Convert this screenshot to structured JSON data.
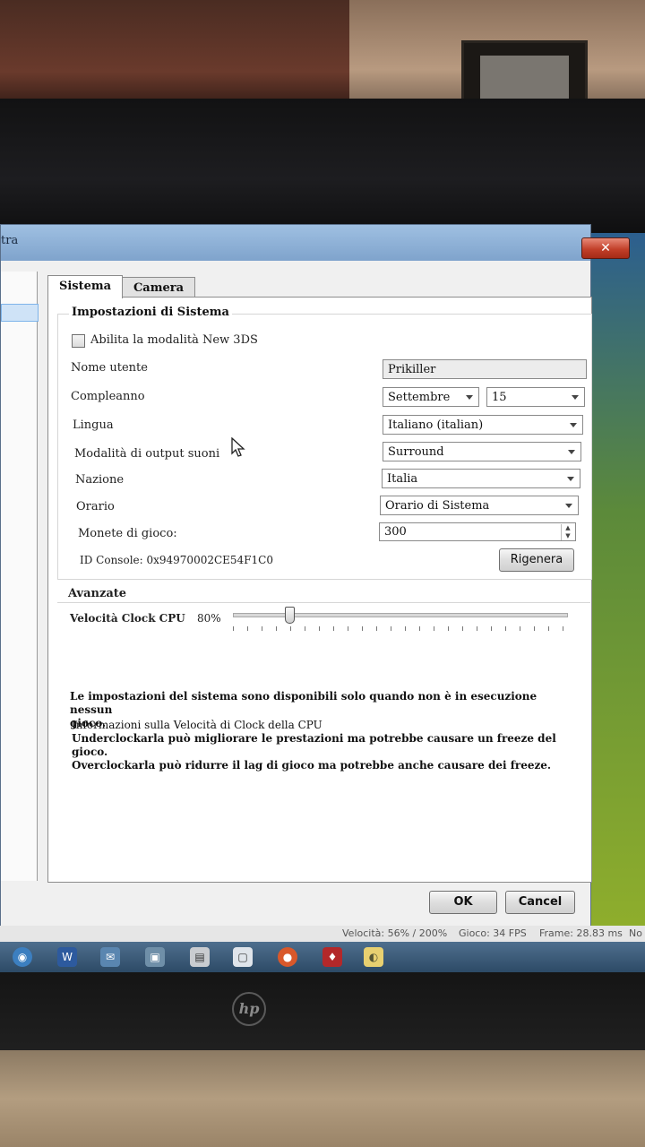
{
  "window": {
    "title": "tra",
    "close_label": "✕"
  },
  "tabs": [
    {
      "label": "Sistema",
      "active": true
    },
    {
      "label": "Camera",
      "active": false
    }
  ],
  "system": {
    "group_title": "Impostazioni di Sistema",
    "new3ds_label": "Abilita la modalità New 3DS",
    "new3ds_checked": false,
    "username_label": "Nome utente",
    "username_value": "Prikiller",
    "birthday_label": "Compleanno",
    "birthday_month": "Settembre",
    "birthday_day": "15",
    "language_label": "Lingua",
    "language_value": "Italiano (italian)",
    "sound_label": "Modalità di output suoni",
    "sound_value": "Surround",
    "country_label": "Nazione",
    "country_value": "Italia",
    "clock_label": "Orario",
    "clock_value": "Orario di Sistema",
    "coins_label": "Monete di gioco:",
    "coins_value": "300",
    "console_id_label": "ID Console: 0x94970002CE54F1C0",
    "regenerate_label": "Rigenera"
  },
  "advanced": {
    "group_title": "Avanzate",
    "cpu_clock_label": "Velocità Clock CPU",
    "cpu_clock_value": "80%",
    "slider_fraction": 0.17
  },
  "notes": {
    "availability_line1": "Le impostazioni del sistema sono disponibili solo quando non è in esecuzione nessun",
    "availability_line2": "gioco.",
    "info_line1": "Informazioni sulla Velocità di Clock della CPU",
    "info_line2": "Underclockarla può migliorare le prestazioni ma potrebbe causare un freeze del gioco.",
    "info_line3": "Overclockarla può ridurre il lag di gioco ma potrebbe anche causare dei freeze."
  },
  "buttons": {
    "ok": "OK",
    "cancel": "Cancel"
  },
  "statusbar": {
    "speed": "Velocità: 56% / 200%",
    "game": "Gioco: 34 FPS",
    "frame": "Frame: 28.83 ms",
    "extra": "No"
  },
  "taskbar": {
    "icons": [
      "start-orb-icon",
      "word-icon",
      "chat-icon",
      "app-icon",
      "emulator-icon",
      "notepad-icon",
      "firefox-icon",
      "game-icon",
      "folder-icon"
    ]
  },
  "hardware": {
    "logo": "hp"
  }
}
